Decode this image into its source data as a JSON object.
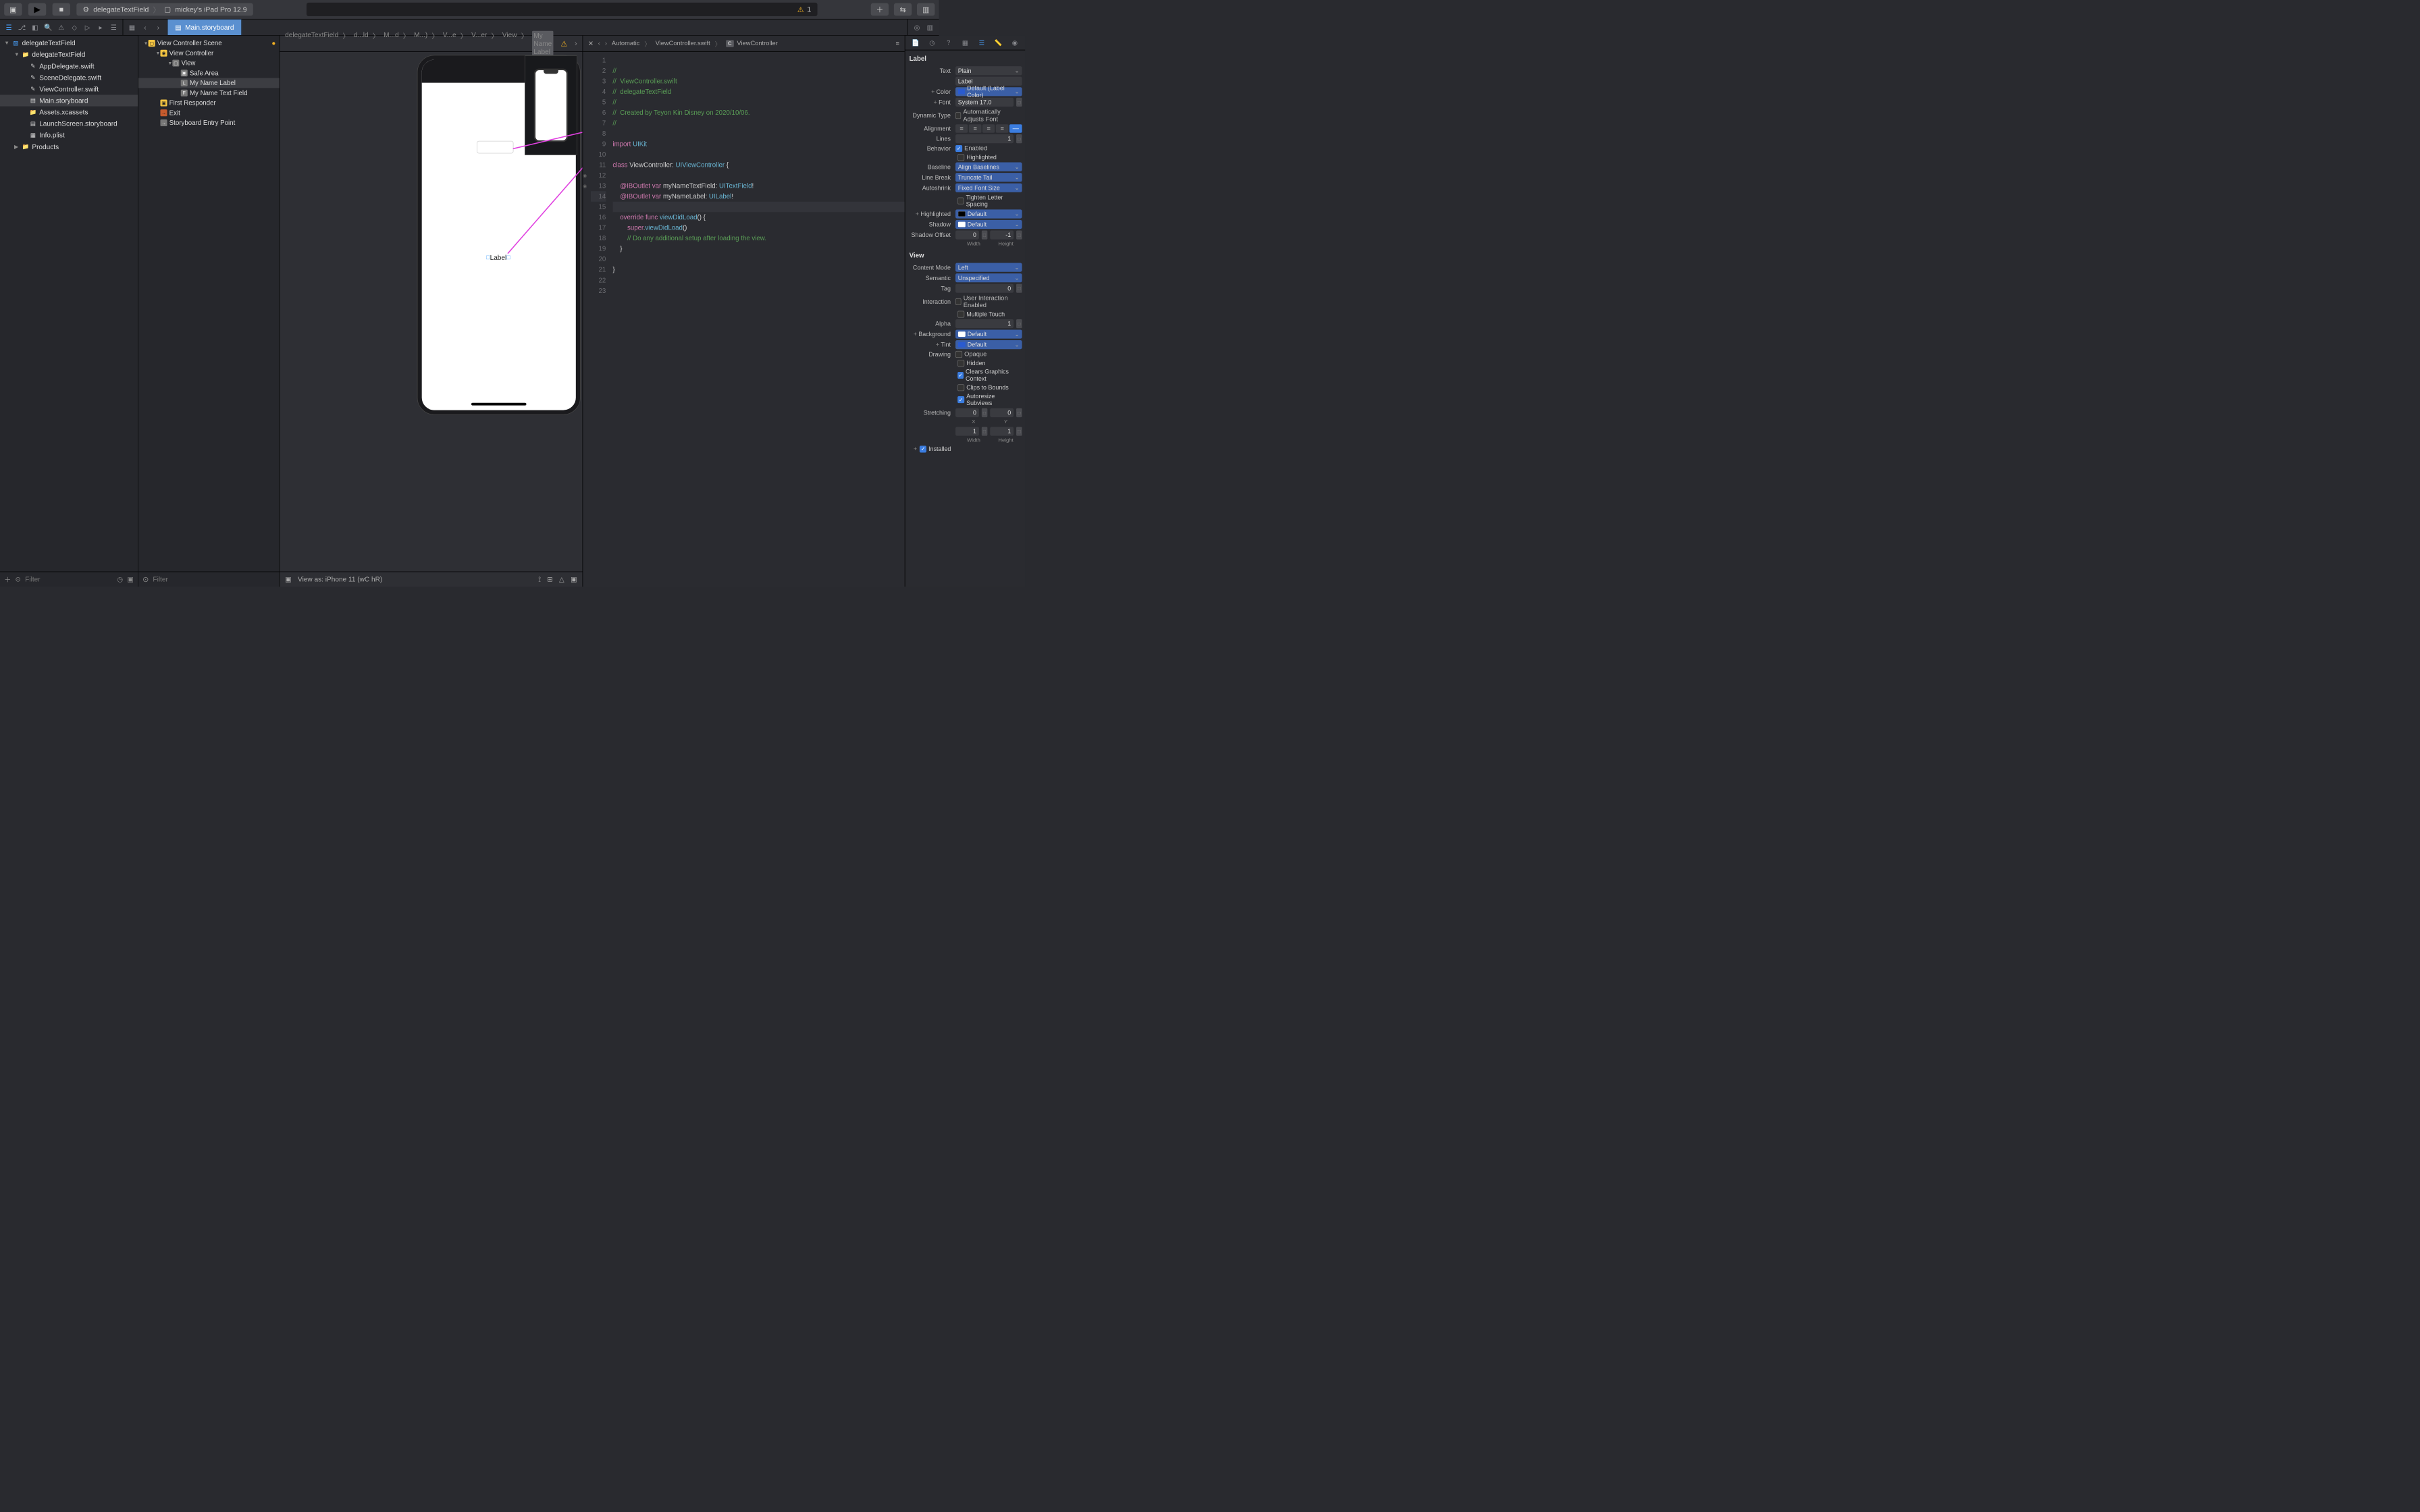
{
  "toolbar": {
    "scheme": "delegateTextField",
    "device": "mickey's iPad Pro 12.9",
    "warning_count": "1"
  },
  "tabs": {
    "active": "Main.storyboard"
  },
  "navigator": {
    "root": "delegateTextField",
    "folder": "delegateTextField",
    "files": [
      "AppDelegate.swift",
      "SceneDelegate.swift",
      "ViewController.swift",
      "Main.storyboard",
      "Assets.xcassets",
      "LaunchScreen.storyboard",
      "Info.plist"
    ],
    "selected": "Main.storyboard",
    "products": "Products",
    "filter_placeholder": "Filter"
  },
  "outline": {
    "scene": "View Controller Scene",
    "vc": "View Controller",
    "safe": "Safe Area",
    "view": "View",
    "label": "My Name Label",
    "tf": "My Name Text Field",
    "fr": "First Responder",
    "exit": "Exit",
    "entry": "Storyboard Entry Point",
    "filter_placeholder": "Filter"
  },
  "breadcrumb_ib": [
    "delegateTextField",
    "d...ld",
    "M...d",
    "M...)",
    "V...e",
    "V...er",
    "View",
    "My Name Label"
  ],
  "breadcrumb_code": [
    "Automatic",
    "ViewController.swift",
    "ViewController"
  ],
  "code": {
    "l1": "//",
    "l2": "//  ViewController.swift",
    "l3": "//  delegateTextField",
    "l4": "//",
    "l5": "//  Created by Teyon Kin Disney on 2020/10/06.",
    "l6": "//",
    "l8_import": "import",
    "l8_uikit": "UIKit",
    "l10_class": "class",
    "l10_name": "ViewController",
    "l10_uiv": "UIViewController",
    "l12_ob": "@IBOutlet",
    "l12_var": "var",
    "l12_name": "myNameTextField",
    "l12_type": "UITextField",
    "l13_name": "myNameLabel",
    "l13_type": "UILabel",
    "l15_override": "override",
    "l15_func": "func",
    "l15_vdl": "viewDidLoad",
    "l16_super": "super",
    "l16_vdl": "viewDidLoad",
    "l17": "// Do any additional setup after loading the view."
  },
  "canvas": {
    "label_text": "Label",
    "view_as": "View as: iPhone 11 (wC hR)"
  },
  "inspector": {
    "label_section": "Label",
    "text_mode": "Plain",
    "text_value": "Label",
    "color": "Default (Label Color)",
    "font": "System 17.0",
    "dynamic_type_cb": "Automatically Adjusts Font",
    "lines": "1",
    "behavior_enabled": "Enabled",
    "behavior_hl": "Highlighted",
    "baseline": "Align Baselines",
    "line_break": "Truncate Tail",
    "autoshrink": "Fixed Font Size",
    "tighten": "Tighten Letter Spacing",
    "hl_color": "Default",
    "shadow": "Default",
    "offset_w": "0",
    "offset_h": "-1",
    "view_section": "View",
    "content_mode": "Left",
    "semantic": "Unspecified",
    "tag": "0",
    "uie": "User Interaction Enabled",
    "mt": "Multiple Touch",
    "alpha": "1",
    "bg": "Default",
    "tint": "Default",
    "opaque": "Opaque",
    "hidden": "Hidden",
    "clears": "Clears Graphics Context",
    "clips": "Clips to Bounds",
    "autoresize": "Autoresize Subviews",
    "sx": "0",
    "sy": "0",
    "sw": "1",
    "sh": "1",
    "installed": "Installed",
    "labels": {
      "text": "Text",
      "color": "Color",
      "font": "Font",
      "dynamic": "Dynamic Type",
      "alignment": "Alignment",
      "lines": "Lines",
      "behavior": "Behavior",
      "baseline": "Baseline",
      "linebreak": "Line Break",
      "autoshrink": "Autoshrink",
      "highlighted": "Highlighted",
      "shadow": "Shadow",
      "offset": "Shadow Offset",
      "width": "Width",
      "height": "Height",
      "content_mode": "Content Mode",
      "semantic": "Semantic",
      "tag": "Tag",
      "interaction": "Interaction",
      "alpha": "Alpha",
      "background": "Background",
      "tint": "Tint",
      "drawing": "Drawing",
      "stretching": "Stretching",
      "x": "X",
      "y": "Y"
    }
  }
}
